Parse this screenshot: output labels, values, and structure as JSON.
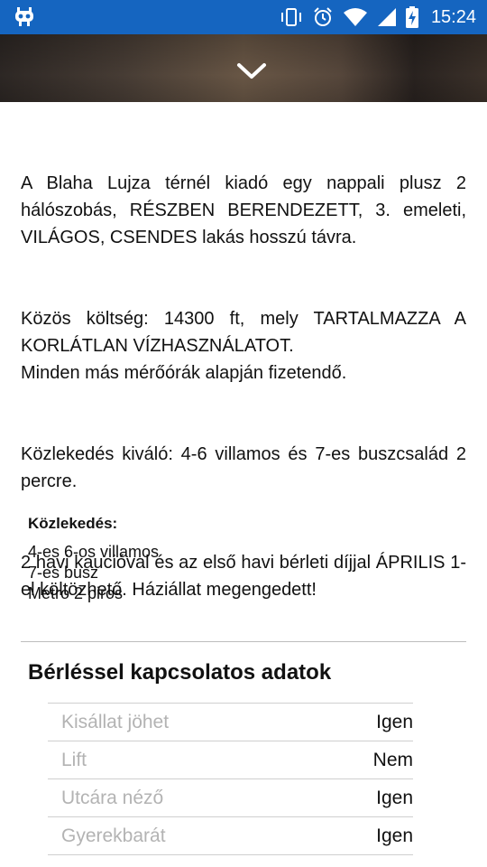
{
  "status_bar": {
    "time": "15:24",
    "icons": [
      "app-notification-icon",
      "vibrate-icon",
      "alarm-icon",
      "wifi-icon",
      "signal-icon",
      "battery-charging-icon"
    ]
  },
  "hero": {
    "collapse_icon": "chevron-down-icon"
  },
  "description": {
    "paragraphs": [
      "A Blaha  Lujza  térnél kiadó egy nappali plusz 2 hálószobás, RÉSZBEN BERENDEZETT, 3. emeleti, VILÁGOS, CSENDES lakás hosszú távra.",
      "Közös  költség: 14300 ft, mely TARTALMAZZA A KORLÁTLAN  VÍZHASZNÁLATOT.\nMinden más mérőórák alapján fizetendő.",
      "Közlekedés    kiváló:    4-6    villamos    és    7-es buszcsalád 2 percre.",
      "2 havi  kaucióval  és  az  első havi bérleti díjjal ÁPRILIS 1-el költözhető. Háziállat megengedett!"
    ]
  },
  "transport": {
    "title": "Közlekedés:",
    "items": [
      "4-es 6-os villamos",
      "7-es busz",
      "Metro 2 piros"
    ]
  },
  "rental_details": {
    "title": "Bérléssel kapcsolatos adatok",
    "rows": [
      {
        "label": "Kisállat jöhet",
        "value": "Igen"
      },
      {
        "label": "Lift",
        "value": "Nem"
      },
      {
        "label": "Utcára néző",
        "value": "Igen"
      },
      {
        "label": "Gyerekbarát",
        "value": "Igen"
      }
    ]
  }
}
